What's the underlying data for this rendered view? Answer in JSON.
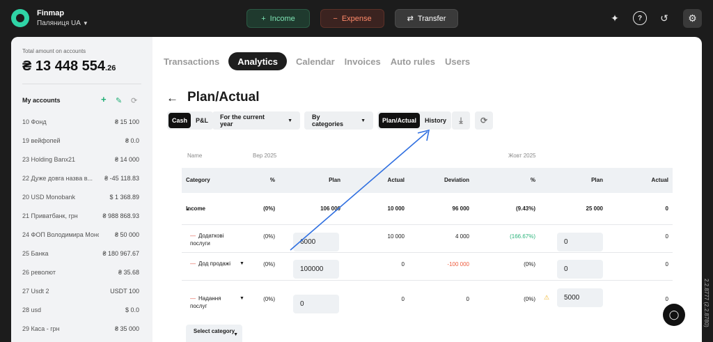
{
  "brand": {
    "name": "Finmap",
    "workspace": "Паляниця UA"
  },
  "top_actions": {
    "income": "Income",
    "expense": "Expense",
    "transfer": "Transfer"
  },
  "sidebar": {
    "total_label": "Total amount on accounts",
    "total_currency": "₴",
    "total_amount": "13 448 554",
    "total_cents": ".26",
    "accounts_title": "My accounts",
    "accounts": [
      {
        "name": "10 Фонд",
        "balance": "₴ 15 100"
      },
      {
        "name": "19 вейфопей",
        "balance": "₴ 0.0"
      },
      {
        "name": "23 Holding Banx21",
        "balance": "₴ 14 000"
      },
      {
        "name": "22 Дуже довга назва в...",
        "balance": "₴ -45 118.83"
      },
      {
        "name": "20 USD Monobank",
        "balance": "$ 1 368.89"
      },
      {
        "name": "21 Приватбанк, грн",
        "balance": "₴ 988 868.93"
      },
      {
        "name": "24 ФОП Володимира Моно",
        "balance": "₴ 50 000"
      },
      {
        "name": "25 Банка",
        "balance": "₴ 180 967.67"
      },
      {
        "name": "26 револют",
        "balance": "₴ 35.68"
      },
      {
        "name": "27 Usdt 2",
        "balance": "USDT 100"
      },
      {
        "name": "28 usd",
        "balance": "$ 0.0"
      },
      {
        "name": "29 Каса - грн",
        "balance": "₴ 35 000"
      }
    ]
  },
  "tabs": [
    "Transactions",
    "Analytics",
    "Calendar",
    "Invoices",
    "Auto rules",
    "Users"
  ],
  "active_tab": "Analytics",
  "page_title": "Plan/Actual",
  "controls": {
    "mode": [
      "Cash",
      "P&L"
    ],
    "period": "For the current year",
    "grouping": "By categories",
    "view": [
      "Plan/Actual",
      "History"
    ]
  },
  "table": {
    "name_label": "Name",
    "month1": "Вер 2025",
    "month2": "Жовт 2025",
    "headers": [
      "Category",
      "%",
      "Plan",
      "Actual",
      "Deviation",
      "%",
      "Plan",
      "Actual"
    ],
    "rows": [
      {
        "category": "Income",
        "pct1": "(0%)",
        "plan1": "106 000",
        "actual1": "10 000",
        "deviation": "96 000",
        "pct2": "(9.43%)",
        "plan2": "25 000",
        "actual2": "0"
      },
      {
        "category": "Додаткові послуги",
        "pct1": "(0%)",
        "plan1": "6000",
        "actual1": "10 000",
        "deviation": "4 000",
        "pct2": "(166.67%)",
        "plan2": "0",
        "actual2": "0"
      },
      {
        "category": "Дод продажі",
        "pct1": "(0%)",
        "plan1": "100000",
        "actual1": "0",
        "deviation": "-100 000",
        "pct2": "(0%)",
        "plan2": "0",
        "actual2": "0"
      },
      {
        "category": "Надання послуг",
        "pct1": "(0%)",
        "plan1": "0",
        "actual1": "0",
        "deviation": "0",
        "pct2": "(0%)",
        "plan2": "5000",
        "actual2": "0"
      }
    ],
    "select_category": "Select category"
  },
  "version": "2.2.8777 (2.2.8780)",
  "colors": {
    "accent_green": "#2fd4a6",
    "danger": "#ee5a3c",
    "annotation_arrow": "#2f6fe0"
  }
}
